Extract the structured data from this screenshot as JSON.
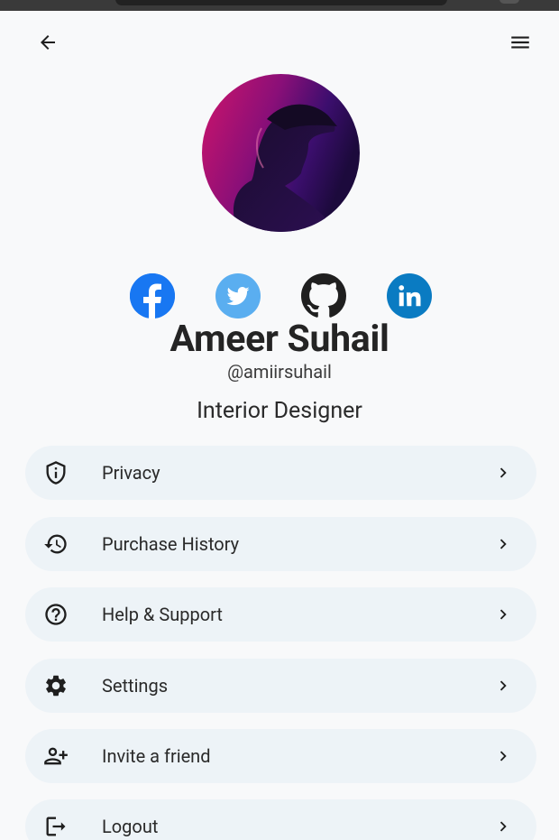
{
  "profile": {
    "name": "Ameer Suhail",
    "handle": "@amiirsuhail",
    "role": "Interior Designer"
  },
  "socials": [
    {
      "name": "facebook",
      "icon": "facebook-icon",
      "color": "#1877f2"
    },
    {
      "name": "twitter",
      "icon": "twitter-icon",
      "color": "#5aaef0"
    },
    {
      "name": "github",
      "icon": "github-icon",
      "color": "#1f1f1f"
    },
    {
      "name": "linkedin",
      "icon": "linkedin-icon",
      "color": "#0a7bc2"
    }
  ],
  "menu": [
    {
      "label": "Privacy",
      "icon": "shield-icon"
    },
    {
      "label": "Purchase History",
      "icon": "history-icon"
    },
    {
      "label": "Help & Support",
      "icon": "help-icon"
    },
    {
      "label": "Settings",
      "icon": "gear-icon"
    },
    {
      "label": "Invite a friend",
      "icon": "add-person-icon"
    },
    {
      "label": "Logout",
      "icon": "logout-icon"
    }
  ],
  "colors": {
    "background": "#f8f9fa",
    "menu_item_bg": "#edf3f7",
    "text": "#2a2a2a"
  }
}
